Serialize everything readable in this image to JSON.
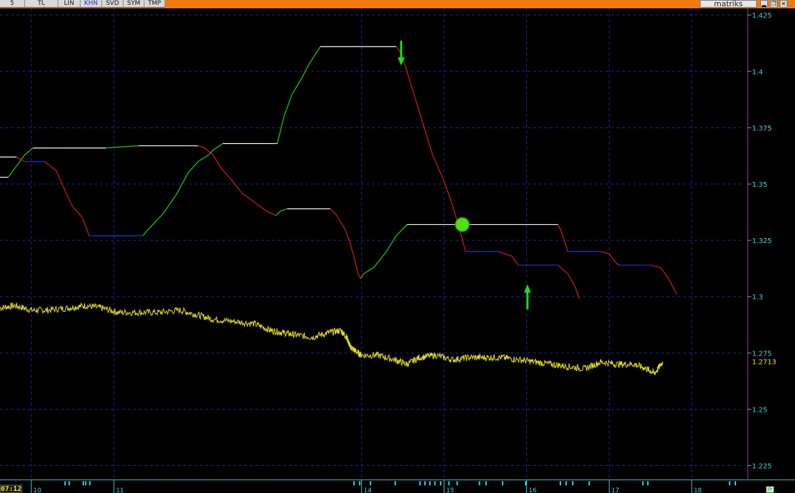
{
  "toolbar": {
    "buttons": [
      {
        "label": "5",
        "active": false
      },
      {
        "label": "TL",
        "active": false
      },
      {
        "label": "LIN",
        "active": false
      },
      {
        "label": "KHN",
        "active": true
      },
      {
        "label": "SVD",
        "active": false
      },
      {
        "label": "SYM",
        "active": false
      },
      {
        "label": "TMP",
        "active": false
      }
    ],
    "brand": "matriks",
    "window_controls": [
      "minimize-icon",
      "restore-icon",
      "close-icon"
    ]
  },
  "status": {
    "time": "07:12"
  },
  "chart_data": {
    "type": "line",
    "background": "#000000",
    "grid": true,
    "grid_color": "#1a2a9a",
    "ylim": [
      1.219,
      1.428
    ],
    "xlim": [
      9.62,
      18.62
    ],
    "y_axis_position": "right",
    "y_ticks": [
      {
        "value": 1.225,
        "label": "1.225"
      },
      {
        "value": 1.25,
        "label": "1.25"
      },
      {
        "value": 1.275,
        "label": "1.275"
      },
      {
        "value": 1.3,
        "label": "1.3"
      },
      {
        "value": 1.325,
        "label": "1.325"
      },
      {
        "value": 1.35,
        "label": "1.35"
      },
      {
        "value": 1.375,
        "label": "1.375"
      },
      {
        "value": 1.4,
        "label": "1.4"
      },
      {
        "value": 1.425,
        "label": "1.425"
      }
    ],
    "x_ticks": [
      {
        "value": 10,
        "label": "10"
      },
      {
        "value": 11,
        "label": "11"
      },
      {
        "value": 14,
        "label": "14"
      },
      {
        "value": 15,
        "label": "15"
      },
      {
        "value": 16,
        "label": "16"
      },
      {
        "value": 17,
        "label": "17"
      },
      {
        "value": 18,
        "label": "18"
      }
    ],
    "last_value": {
      "value": 1.2713,
      "label": "1.2713",
      "color": "#e8e020"
    },
    "series": [
      {
        "color_rising": "#18d818",
        "color_falling": "#e01818",
        "color_flat_rising": "#ffffff",
        "color_flat_falling": "#2030e8",
        "points": [
          [
            9.62,
            1.353
          ],
          [
            9.72,
            1.353
          ],
          [
            9.82,
            1.358
          ],
          [
            9.92,
            1.363
          ],
          [
            10.02,
            1.366
          ],
          [
            10.3,
            1.366
          ],
          [
            10.9,
            1.366
          ],
          [
            11.3,
            1.367
          ],
          [
            11.9,
            1.367
          ],
          [
            12.02,
            1.367
          ],
          [
            12.1,
            1.366
          ],
          [
            12.2,
            1.363
          ],
          [
            12.3,
            1.357
          ],
          [
            12.42,
            1.352
          ],
          [
            12.55,
            1.346
          ],
          [
            12.7,
            1.342
          ],
          [
            12.85,
            1.338
          ],
          [
            12.96,
            1.336
          ],
          [
            13.02,
            1.338
          ],
          [
            13.1,
            1.339
          ],
          [
            13.5,
            1.339
          ],
          [
            13.62,
            1.339
          ],
          [
            13.7,
            1.336
          ],
          [
            13.8,
            1.33
          ],
          [
            13.86,
            1.324
          ],
          [
            13.92,
            1.316
          ],
          [
            13.96,
            1.31
          ],
          [
            13.99,
            1.308
          ],
          [
            14.02,
            1.31
          ],
          [
            14.15,
            1.313
          ],
          [
            14.3,
            1.32
          ],
          [
            14.42,
            1.327
          ],
          [
            14.55,
            1.332
          ],
          [
            14.75,
            1.332
          ],
          [
            15.3,
            1.332
          ],
          [
            15.9,
            1.332
          ],
          [
            16.38,
            1.332
          ],
          [
            16.42,
            1.329
          ],
          [
            16.5,
            1.32
          ],
          [
            16.55,
            1.32
          ],
          [
            16.9,
            1.32
          ],
          [
            17.0,
            1.319
          ],
          [
            17.08,
            1.315
          ],
          [
            17.12,
            1.314
          ],
          [
            17.5,
            1.314
          ],
          [
            17.62,
            1.313
          ],
          [
            17.72,
            1.308
          ],
          [
            17.82,
            1.301
          ]
        ]
      },
      {
        "color_rising": "#18d818",
        "color_falling": "#e01818",
        "color_flat_rising": "#ffffff",
        "color_flat_falling": "#2030e8",
        "points": [
          [
            9.62,
            1.362
          ],
          [
            9.82,
            1.362
          ],
          [
            9.92,
            1.36
          ],
          [
            10.16,
            1.36
          ],
          [
            10.3,
            1.356
          ],
          [
            10.42,
            1.346
          ],
          [
            10.5,
            1.34
          ],
          [
            10.62,
            1.335
          ],
          [
            10.7,
            1.327
          ],
          [
            10.73,
            1.327
          ],
          [
            11.3,
            1.327
          ],
          [
            11.35,
            1.327
          ],
          [
            11.42,
            1.33
          ],
          [
            11.6,
            1.337
          ],
          [
            11.75,
            1.345
          ],
          [
            11.9,
            1.355
          ],
          [
            12.02,
            1.36
          ],
          [
            12.15,
            1.363
          ],
          [
            12.2,
            1.365
          ],
          [
            12.32,
            1.368
          ],
          [
            12.5,
            1.368
          ],
          [
            12.9,
            1.368
          ],
          [
            12.98,
            1.368
          ],
          [
            13.06,
            1.38
          ],
          [
            13.16,
            1.39
          ],
          [
            13.26,
            1.396
          ],
          [
            13.36,
            1.403
          ],
          [
            13.5,
            1.411
          ],
          [
            14.42,
            1.411
          ],
          [
            14.48,
            1.408
          ],
          [
            14.55,
            1.4
          ],
          [
            14.65,
            1.388
          ],
          [
            14.76,
            1.375
          ],
          [
            14.86,
            1.363
          ],
          [
            14.98,
            1.353
          ],
          [
            15.08,
            1.343
          ],
          [
            15.18,
            1.331
          ],
          [
            15.26,
            1.32
          ],
          [
            15.52,
            1.32
          ],
          [
            15.66,
            1.32
          ],
          [
            15.82,
            1.318
          ],
          [
            15.9,
            1.314
          ],
          [
            16.3,
            1.314
          ],
          [
            16.38,
            1.314
          ],
          [
            16.5,
            1.31
          ],
          [
            16.58,
            1.305
          ],
          [
            16.64,
            1.299
          ]
        ]
      },
      {
        "color": "#e8e020",
        "points": [
          [
            9.62,
            1.295
          ],
          [
            9.8,
            1.296
          ],
          [
            10.0,
            1.294
          ],
          [
            10.2,
            1.294
          ],
          [
            10.45,
            1.295
          ],
          [
            10.65,
            1.296
          ],
          [
            10.85,
            1.295
          ],
          [
            11.05,
            1.293
          ],
          [
            11.3,
            1.293
          ],
          [
            11.55,
            1.293
          ],
          [
            11.8,
            1.294
          ],
          [
            12.0,
            1.292
          ],
          [
            12.2,
            1.29
          ],
          [
            12.45,
            1.289
          ],
          [
            12.7,
            1.288
          ],
          [
            12.9,
            1.285
          ],
          [
            13.05,
            1.284
          ],
          [
            13.2,
            1.283
          ],
          [
            13.4,
            1.282
          ],
          [
            13.6,
            1.284
          ],
          [
            13.75,
            1.285
          ],
          [
            13.82,
            1.282
          ],
          [
            13.86,
            1.278
          ],
          [
            13.92,
            1.276
          ],
          [
            14.0,
            1.274
          ],
          [
            14.2,
            1.274
          ],
          [
            14.4,
            1.272
          ],
          [
            14.55,
            1.27
          ],
          [
            14.7,
            1.273
          ],
          [
            14.9,
            1.274
          ],
          [
            15.1,
            1.272
          ],
          [
            15.3,
            1.273
          ],
          [
            15.5,
            1.273
          ],
          [
            15.7,
            1.273
          ],
          [
            15.9,
            1.272
          ],
          [
            16.1,
            1.271
          ],
          [
            16.3,
            1.27
          ],
          [
            16.5,
            1.269
          ],
          [
            16.7,
            1.268
          ],
          [
            16.9,
            1.271
          ],
          [
            17.1,
            1.27
          ],
          [
            17.3,
            1.27
          ],
          [
            17.45,
            1.268
          ],
          [
            17.55,
            1.266
          ],
          [
            17.65,
            1.271
          ]
        ]
      }
    ],
    "markers": [
      {
        "type": "arrow-down",
        "x": 14.48,
        "y": 1.405,
        "color": "#18e018"
      },
      {
        "type": "arrow-up",
        "x": 16.01,
        "y": 1.303,
        "color": "#18e018"
      },
      {
        "type": "circle",
        "x": 15.22,
        "y": 1.332,
        "color": "#50e010"
      }
    ],
    "bottom_ticks_x": [
      10.4,
      10.45,
      10.62,
      10.65,
      10.7,
      13.9,
      13.97,
      14.1,
      14.4,
      14.7,
      14.76,
      14.82,
      14.88,
      14.95,
      15.05,
      15.15,
      15.42,
      15.5,
      15.7,
      15.98,
      16.4,
      16.47,
      16.55,
      16.75,
      17.4,
      17.46,
      18.45,
      18.52
    ]
  }
}
